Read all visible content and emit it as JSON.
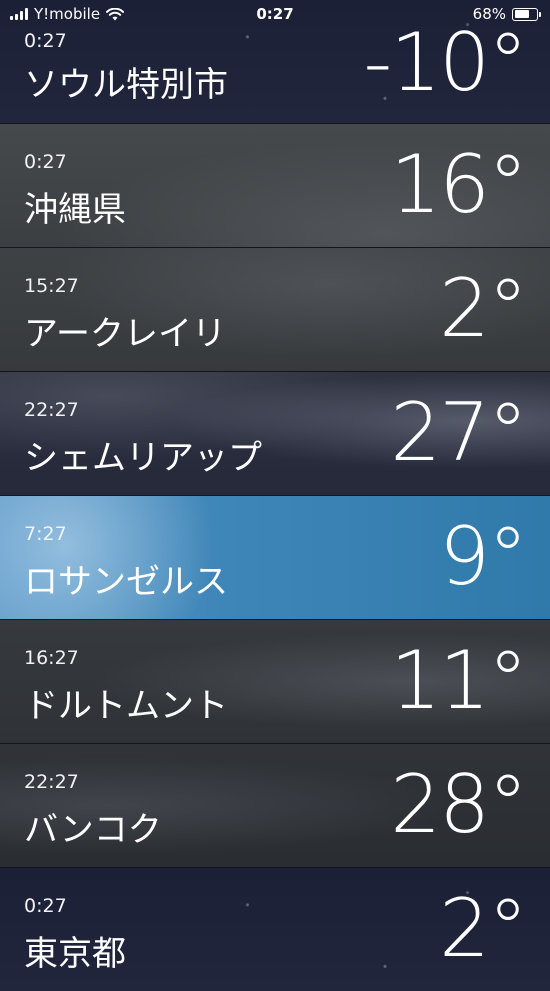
{
  "status_bar": {
    "carrier": "Y!mobile",
    "time": "0:27",
    "battery_percent": "68%",
    "battery_level": 0.68,
    "signal_icon": "signal-bars-icon",
    "wifi_icon": "wifi-icon"
  },
  "cities": [
    {
      "time": "0:27",
      "name": "ソウル特別市",
      "temp": "-10°",
      "theme": "night-clear"
    },
    {
      "time": "0:27",
      "name": "沖縄県",
      "temp": "16°",
      "theme": "night-cloudy"
    },
    {
      "time": "15:27",
      "name": "アークレイリ",
      "temp": "2°",
      "theme": "overcast"
    },
    {
      "time": "22:27",
      "name": "シェムリアップ",
      "temp": "27°",
      "theme": "night-clouds"
    },
    {
      "time": "7:27",
      "name": "ロサンゼルス",
      "temp": "9°",
      "theme": "day-clear"
    },
    {
      "time": "16:27",
      "name": "ドルトムント",
      "temp": "11°",
      "theme": "overcast"
    },
    {
      "time": "22:27",
      "name": "バンコク",
      "temp": "28°",
      "theme": "night-cloudy"
    },
    {
      "time": "0:27",
      "name": "東京都",
      "temp": "2°",
      "theme": "night-clear"
    }
  ]
}
